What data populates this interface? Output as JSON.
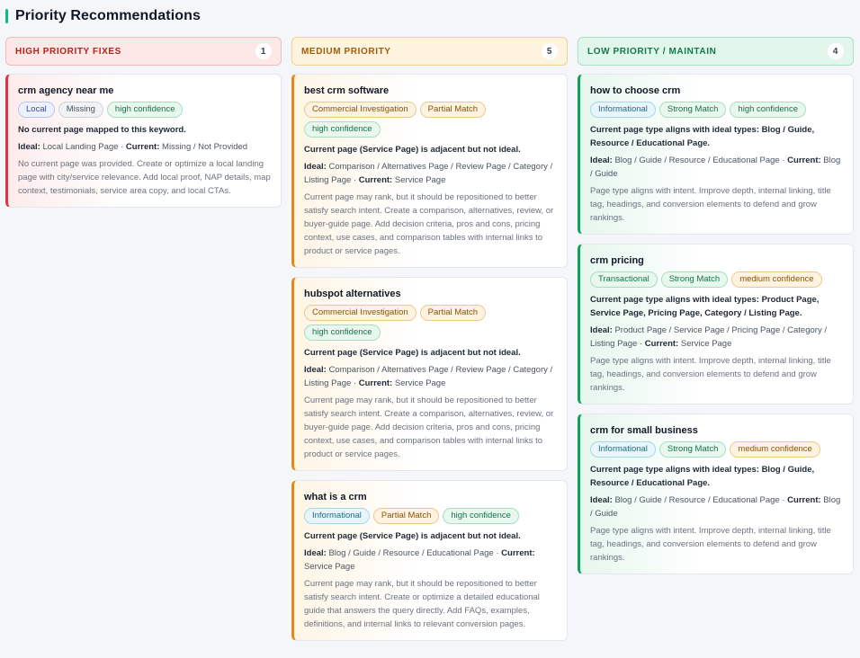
{
  "page": {
    "title": "Priority Recommendations"
  },
  "columns": [
    {
      "header": "HIGH PRIORITY FIXES",
      "count": "1",
      "cards": [
        {
          "keyword": "crm agency near me",
          "tags": [
            {
              "label": "Local",
              "style": "blue"
            },
            {
              "label": "Missing",
              "style": "gray"
            },
            {
              "label": "high confidence",
              "style": "green"
            }
          ],
          "summary": "No current page mapped to this keyword.",
          "ideal_label": "Ideal:",
          "ideal": "Local Landing Page",
          "current_label": "Current:",
          "current": "Missing / Not Provided",
          "description": "No current page was provided. Create or optimize a local landing page with city/service relevance. Add local proof, NAP details, map context, testimonials, service area copy, and local CTAs."
        }
      ]
    },
    {
      "header": "MEDIUM PRIORITY",
      "count": "5",
      "cards": [
        {
          "keyword": "best crm software",
          "tags": [
            {
              "label": "Commercial Investigation",
              "style": "amber"
            },
            {
              "label": "Partial Match",
              "style": "amber"
            },
            {
              "label": "high confidence",
              "style": "green"
            }
          ],
          "summary": "Current page (Service Page) is adjacent but not ideal.",
          "ideal_label": "Ideal:",
          "ideal": "Comparison / Alternatives Page / Review Page / Category / Listing Page",
          "current_label": "Current:",
          "current": "Service Page",
          "description": "Current page may rank, but it should be repositioned to better satisfy search intent. Create a comparison, alternatives, review, or buyer-guide page. Add decision criteria, pros and cons, pricing context, use cases, and comparison tables with internal links to product or service pages."
        },
        {
          "keyword": "hubspot alternatives",
          "tags": [
            {
              "label": "Commercial Investigation",
              "style": "amber"
            },
            {
              "label": "Partial Match",
              "style": "amber"
            },
            {
              "label": "high confidence",
              "style": "green"
            }
          ],
          "summary": "Current page (Service Page) is adjacent but not ideal.",
          "ideal_label": "Ideal:",
          "ideal": "Comparison / Alternatives Page / Review Page / Category / Listing Page",
          "current_label": "Current:",
          "current": "Service Page",
          "description": "Current page may rank, but it should be repositioned to better satisfy search intent. Create a comparison, alternatives, review, or buyer-guide page. Add decision criteria, pros and cons, pricing context, use cases, and comparison tables with internal links to product or service pages."
        },
        {
          "keyword": "what is a crm",
          "tags": [
            {
              "label": "Informational",
              "style": "cyan"
            },
            {
              "label": "Partial Match",
              "style": "amber"
            },
            {
              "label": "high confidence",
              "style": "green"
            }
          ],
          "summary": "Current page (Service Page) is adjacent but not ideal.",
          "ideal_label": "Ideal:",
          "ideal": "Blog / Guide / Resource / Educational Page",
          "current_label": "Current:",
          "current": "Service Page",
          "description": "Current page may rank, but it should be repositioned to better satisfy search intent. Create or optimize a detailed educational guide that answers the query directly. Add FAQs, examples, definitions, and internal links to relevant conversion pages."
        }
      ]
    },
    {
      "header": "LOW PRIORITY / MAINTAIN",
      "count": "4",
      "cards": [
        {
          "keyword": "how to choose crm",
          "tags": [
            {
              "label": "Informational",
              "style": "cyan"
            },
            {
              "label": "Strong Match",
              "style": "green"
            },
            {
              "label": "high confidence",
              "style": "green"
            }
          ],
          "summary": "Current page type aligns with ideal types: Blog / Guide, Resource / Educational Page.",
          "ideal_label": "Ideal:",
          "ideal": "Blog / Guide / Resource / Educational Page",
          "current_label": "Current:",
          "current": "Blog / Guide",
          "description": "Page type aligns with intent. Improve depth, internal linking, title tag, headings, and conversion elements to defend and grow rankings."
        },
        {
          "keyword": "crm pricing",
          "tags": [
            {
              "label": "Transactional",
              "style": "green"
            },
            {
              "label": "Strong Match",
              "style": "green"
            },
            {
              "label": "medium confidence",
              "style": "amber"
            }
          ],
          "summary": "Current page type aligns with ideal types: Product Page, Service Page, Pricing Page, Category / Listing Page.",
          "ideal_label": "Ideal:",
          "ideal": "Product Page / Service Page / Pricing Page / Category / Listing Page",
          "current_label": "Current:",
          "current": "Service Page",
          "description": "Page type aligns with intent. Improve depth, internal linking, title tag, headings, and conversion elements to defend and grow rankings."
        },
        {
          "keyword": "crm for small business",
          "tags": [
            {
              "label": "Informational",
              "style": "cyan"
            },
            {
              "label": "Strong Match",
              "style": "green"
            },
            {
              "label": "medium confidence",
              "style": "amber"
            }
          ],
          "summary": "Current page type aligns with ideal types: Blog / Guide, Resource / Educational Page.",
          "ideal_label": "Ideal:",
          "ideal": "Blog / Guide / Resource / Educational Page",
          "current_label": "Current:",
          "current": "Blog / Guide",
          "description": "Page type aligns with intent. Improve depth, internal linking, title tag, headings, and conversion elements to defend and grow rankings."
        }
      ]
    }
  ]
}
